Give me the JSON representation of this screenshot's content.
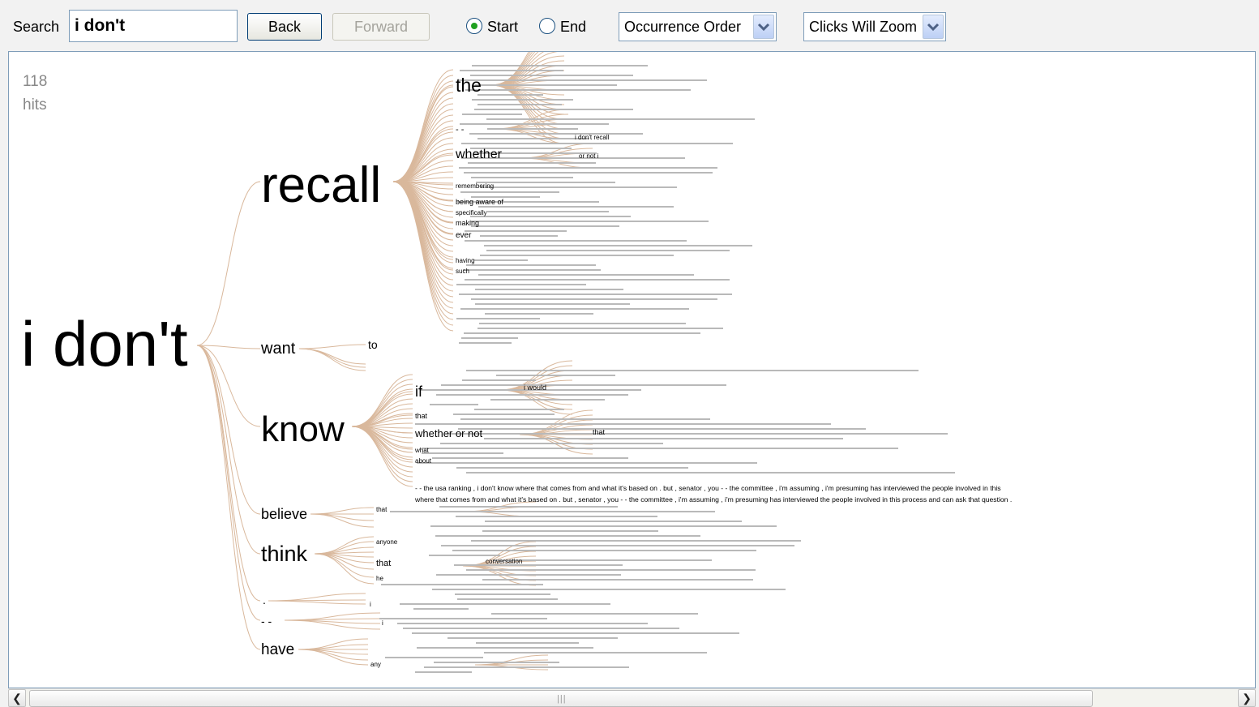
{
  "toolbar": {
    "search_label": "Search",
    "search_value": "i don't",
    "back_label": "Back",
    "forward_label": "Forward",
    "radio_start_label": "Start",
    "radio_end_label": "End",
    "radio_selected": "Start",
    "order_select_value": "Occurrence Order",
    "zoom_select_value": "Clicks Will Zoom"
  },
  "tree": {
    "hits_count": "118",
    "hits_label": "hits",
    "root": "i don't",
    "branches": [
      {
        "word": "recall",
        "children": [
          "the",
          "- -",
          "whether",
          "remembering",
          "being aware of",
          "specifically",
          "making",
          "ever",
          "having",
          "such"
        ]
      },
      {
        "word": "want",
        "children": [
          "to"
        ]
      },
      {
        "word": "know",
        "children": [
          "if",
          "that",
          "whether or not",
          "what",
          "about"
        ]
      },
      {
        "word": "believe",
        "children": [
          "that"
        ]
      },
      {
        "word": "think",
        "children": [
          "anyone",
          "that",
          "he"
        ]
      },
      {
        "word": ".",
        "children": [
          "i"
        ]
      },
      {
        "word": "- -",
        "children": [
          "i"
        ]
      },
      {
        "word": "have",
        "children": [
          "any"
        ]
      }
    ],
    "sub_phrases": {
      "recall_whether": "or not i",
      "recall_dash": "i don't recall",
      "know_if": "i would",
      "know_whether": "that",
      "think_that": "conversation"
    },
    "long_line_1": "- - the usa ranking , i don't know where that comes from and what it's based on . but , senator , you - - the committee , i'm assuming , i'm presuming has interviewed the people involved in this",
    "long_line_2": "where that comes from and what it's based on . but , senator , you - - the committee , i'm assuming , i'm presuming has interviewed the people involved in this process and can ask that question ."
  },
  "colors": {
    "branch": "#d9b89c",
    "accent_radio": "#21a121",
    "panel_border": "#7f9db9"
  },
  "icons": {
    "select_arrow": "chevron-down-icon",
    "scroll_left": "scroll-left-icon",
    "scroll_right": "scroll-right-icon"
  }
}
